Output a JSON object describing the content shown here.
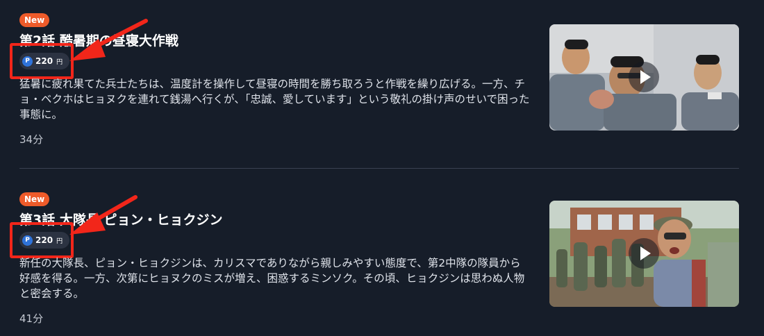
{
  "episodes": [
    {
      "badge": "New",
      "title": "第2話 酷暑期の昼寝大作戦",
      "price": {
        "coin_label": "P",
        "value": "220",
        "unit": "円"
      },
      "description": "猛暑に疲れ果てた兵士たちは、温度計を操作して昼寝の時間を勝ち取ろうと作戦を繰り広げる。一方、チョ・ベクホはヒョヌクを連れて銭湯へ行くが、「忠誠、愛しています」という敬礼の掛け声のせいで困った事態に。",
      "duration": "34分"
    },
    {
      "badge": "New",
      "title": "第3話 大隊長 ピョン・ヒョクジン",
      "price": {
        "coin_label": "P",
        "value": "220",
        "unit": "円"
      },
      "description": "新任の大隊長、ピョン・ヒョクジンは、カリスマでありながら親しみやすい態度で、第2中隊の隊員から好感を得る。一方、次第にヒョヌクのミスが増え、困惑するミンソク。その頃、ヒョクジンは思わぬ人物と密会する。",
      "duration": "41分"
    }
  ],
  "colors": {
    "background": "#161d29",
    "badge": "#ee5b2a",
    "highlight": "#f2261a",
    "coin": "#2f73d9"
  },
  "icons": [
    "play-icon",
    "point-coin-icon",
    "annotation-arrow"
  ]
}
